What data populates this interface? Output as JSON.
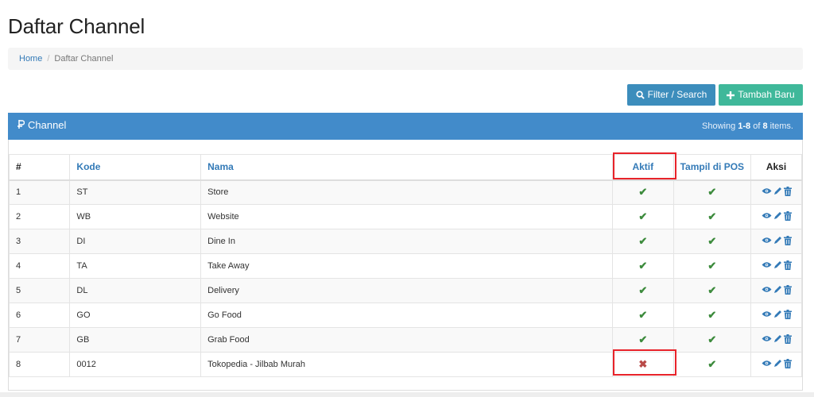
{
  "page": {
    "title": "Daftar Channel"
  },
  "breadcrumb": {
    "home": "Home",
    "separator": "/",
    "current": "Daftar Channel"
  },
  "toolbar": {
    "filter_label": "Filter / Search",
    "add_label": "Tambah Baru"
  },
  "panel": {
    "title": "Channel",
    "summary_prefix": "Showing ",
    "summary_range": "1-8",
    "summary_of": " of ",
    "summary_total": "8",
    "summary_suffix": " items."
  },
  "table": {
    "headers": {
      "num": "#",
      "kode": "Kode",
      "nama": "Nama",
      "aktif": "Aktif",
      "pos": "Tampil di POS",
      "aksi": "Aksi"
    },
    "rows": [
      {
        "num": "1",
        "kode": "ST",
        "nama": "Store",
        "aktif": true,
        "pos": true
      },
      {
        "num": "2",
        "kode": "WB",
        "nama": "Website",
        "aktif": true,
        "pos": true
      },
      {
        "num": "3",
        "kode": "DI",
        "nama": "Dine In",
        "aktif": true,
        "pos": true
      },
      {
        "num": "4",
        "kode": "TA",
        "nama": "Take Away",
        "aktif": true,
        "pos": true
      },
      {
        "num": "5",
        "kode": "DL",
        "nama": "Delivery",
        "aktif": true,
        "pos": true
      },
      {
        "num": "6",
        "kode": "GO",
        "nama": "Go Food",
        "aktif": true,
        "pos": true
      },
      {
        "num": "7",
        "kode": "GB",
        "nama": "Grab Food",
        "aktif": true,
        "pos": true
      },
      {
        "num": "8",
        "kode": "0012",
        "nama": "Tokopedia - Jilbab Murah",
        "aktif": false,
        "pos": true
      }
    ]
  },
  "icons": {
    "filter": "search-icon",
    "add": "plus-icon",
    "panel": "channel-icon",
    "true": "check-icon",
    "false": "cross-icon",
    "view": "eye-icon",
    "edit": "pencil-icon",
    "delete": "trash-icon"
  },
  "colors": {
    "primary": "#428bca",
    "filter_button": "#3c8dbc",
    "add_button": "#3fb89a",
    "check": "#3d8b3d",
    "cross": "#b94a48",
    "highlight": "#e8232a"
  }
}
